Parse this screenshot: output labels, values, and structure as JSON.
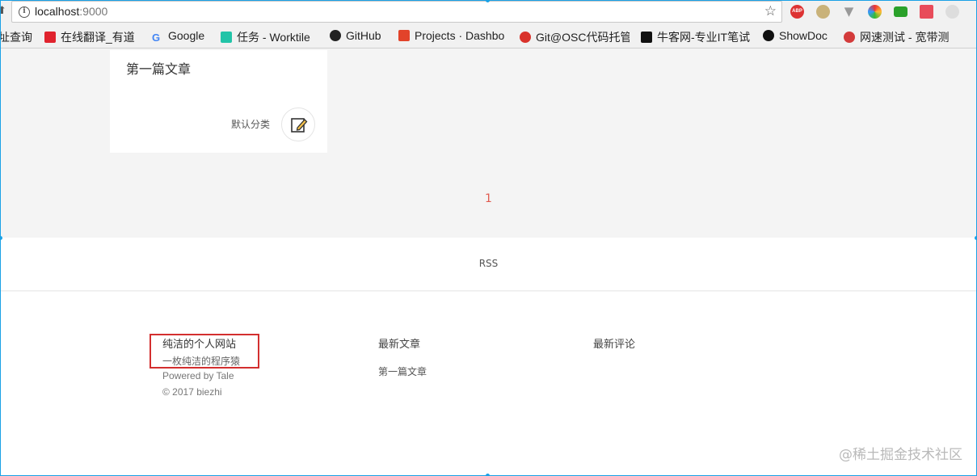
{
  "browser": {
    "url_host": "localhost",
    "url_port": ":9000",
    "bookmarks": [
      {
        "label": "址查询",
        "icon": "bookmark-icon",
        "color": "#777777"
      },
      {
        "label": "在线翻译_有道",
        "icon": "youdao-icon",
        "color": "#e0232e"
      },
      {
        "label": "Google",
        "icon": "google-icon",
        "color": "#4285f4"
      },
      {
        "label": "任务 - Worktile",
        "icon": "worktile-icon",
        "color": "#22c4a8"
      },
      {
        "label": "GitHub",
        "icon": "github-icon",
        "color": "#222222"
      },
      {
        "label": "Projects · Dashbo",
        "icon": "gitlab-icon",
        "color": "#e2432a"
      },
      {
        "label": "Git@OSC代码托管",
        "icon": "gitosc-icon",
        "color": "#d9322b"
      },
      {
        "label": "牛客网-专业IT笔试",
        "icon": "nowcoder-icon",
        "color": "#111111"
      },
      {
        "label": "ShowDoc",
        "icon": "showdoc-icon",
        "color": "#111111"
      },
      {
        "label": "网速测试 - 宽带测",
        "icon": "speedtest-icon",
        "color": "#d33b3b"
      }
    ],
    "extensions": [
      "adblock-icon",
      "extension-circle-icon",
      "vue-devtools-icon",
      "speed-icon",
      "tv-icon",
      "flag-icon",
      "extension-gray-icon"
    ],
    "adblock_label": "ABP"
  },
  "post": {
    "title": "第一篇文章",
    "category": "默认分类"
  },
  "pagination": {
    "current_page": "1"
  },
  "rss": {
    "label": "RSS"
  },
  "footer": {
    "site_title": "纯洁的个人网站",
    "site_desc": "一枚纯洁的程序猿",
    "powered": "Powered by Tale",
    "copyright": "© 2017 biezhi",
    "latest_posts_heading": "最新文章",
    "latest_posts": [
      "第一篇文章"
    ],
    "latest_comments_heading": "最新评论"
  },
  "watermark": "@稀土掘金技术社区",
  "colors": {
    "accent_red": "#e05a4f",
    "highlight_box": "#d32f2f",
    "selection_frame": "#1aa1e6"
  }
}
